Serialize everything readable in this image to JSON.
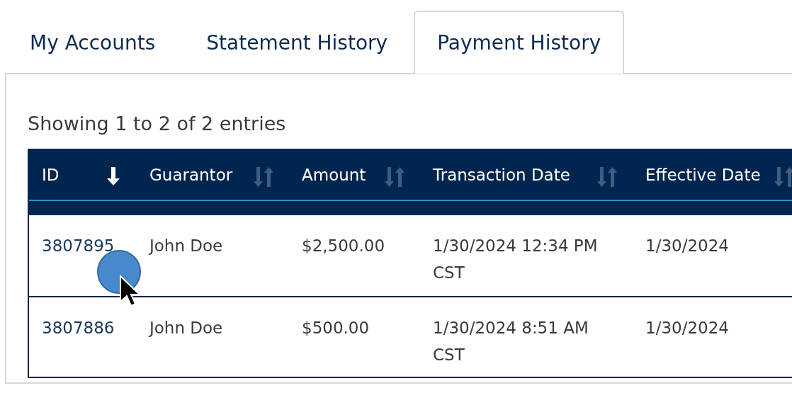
{
  "tabs": [
    {
      "label": "My Accounts",
      "selected": false
    },
    {
      "label": "Statement History",
      "selected": false
    },
    {
      "label": "Payment History",
      "selected": true
    }
  ],
  "summary": "Showing 1 to 2 of 2 entries",
  "table": {
    "columns": [
      {
        "label": "ID",
        "sorted": true
      },
      {
        "label": "Guarantor",
        "sorted": false
      },
      {
        "label": "Amount",
        "sorted": false
      },
      {
        "label": "Transaction Date",
        "sorted": false
      },
      {
        "label": "Effective Date",
        "sorted": false
      }
    ],
    "rows": [
      {
        "id": "3807895",
        "guarantor": "John Doe",
        "amount": "$2,500.00",
        "transaction_date": [
          "1/30/2024 12:34 PM",
          "CST"
        ],
        "effective_date": "1/30/2024"
      },
      {
        "id": "3807886",
        "guarantor": "John Doe",
        "amount": "$500.00",
        "transaction_date": [
          "1/30/2024 8:51 AM",
          "CST"
        ],
        "effective_date": "1/30/2024"
      }
    ]
  }
}
